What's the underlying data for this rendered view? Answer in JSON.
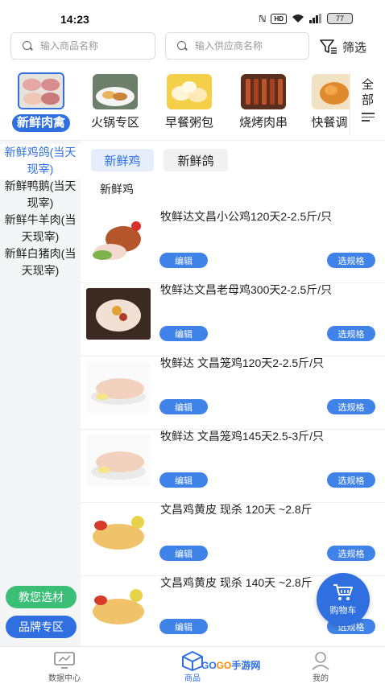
{
  "status_bar": {
    "time": "14:23",
    "hd_label": "HD",
    "battery": "77"
  },
  "search": {
    "goods_placeholder": "输入商品名称",
    "supplier_placeholder": "输入供应商名称",
    "filter_label": "筛选"
  },
  "categories": [
    {
      "label": "新鲜肉禽",
      "icon": "raw-meat-image",
      "active": true
    },
    {
      "label": "火锅专区",
      "icon": "hotpot-image",
      "active": false
    },
    {
      "label": "早餐粥包",
      "icon": "breakfast-image",
      "active": false
    },
    {
      "label": "烧烤肉串",
      "icon": "bbq-skewer-image",
      "active": false
    },
    {
      "label": "快餐调",
      "icon": "fastfood-image",
      "active": false
    }
  ],
  "all_categories_label": "全部",
  "sidebar": {
    "items": [
      {
        "label": "新鲜鸡鸽(当天现宰)",
        "active": true
      },
      {
        "label": "新鲜鸭鹅(当天现宰)",
        "active": false
      },
      {
        "label": "新鲜牛羊肉(当天现宰)",
        "active": false
      },
      {
        "label": "新鲜白猪肉(当天现宰)",
        "active": false
      }
    ],
    "guide_button": "教您选材",
    "brand_button": "品牌专区"
  },
  "sub_tabs": [
    {
      "label": "新鲜鸡",
      "active": true
    },
    {
      "label": "新鲜鸽",
      "active": false
    }
  ],
  "section_title": "新鲜鸡",
  "products": [
    {
      "name": "牧鲜达文昌小公鸡120天2-2.5斤/只",
      "edit": "编辑",
      "spec": "选规格"
    },
    {
      "name": "牧鲜达文昌老母鸡300天2-2.5斤/只",
      "edit": "编辑",
      "spec": "选规格"
    },
    {
      "name": "牧鲜达 文昌笼鸡120天2-2.5斤/只",
      "edit": "编辑",
      "spec": "选规格"
    },
    {
      "name": "牧鲜达 文昌笼鸡145天2.5-3斤/只",
      "edit": "编辑",
      "spec": "选规格"
    },
    {
      "name": "文昌鸡黄皮 现杀 120天 ~2.8斤",
      "edit": "编辑",
      "spec": "选规格"
    },
    {
      "name": "文昌鸡黄皮 现杀 140天 ~2.8斤",
      "edit": "编辑",
      "spec": "选规格"
    }
  ],
  "cart_label": "购物车",
  "bottom_nav": [
    {
      "label": "数据中心",
      "icon": "monitor-icon",
      "active": false
    },
    {
      "label": "商品",
      "icon": "box-icon",
      "active": true
    },
    {
      "label": "我的",
      "icon": "user-icon",
      "active": false
    }
  ],
  "watermark": {
    "brand_a": "GO",
    "brand_b": "GO",
    "suffix": "手游网"
  },
  "colors": {
    "accent": "#2f6fe0",
    "guide_green": "#3bbf76",
    "sidebar_bg": "#f4f5f7"
  }
}
